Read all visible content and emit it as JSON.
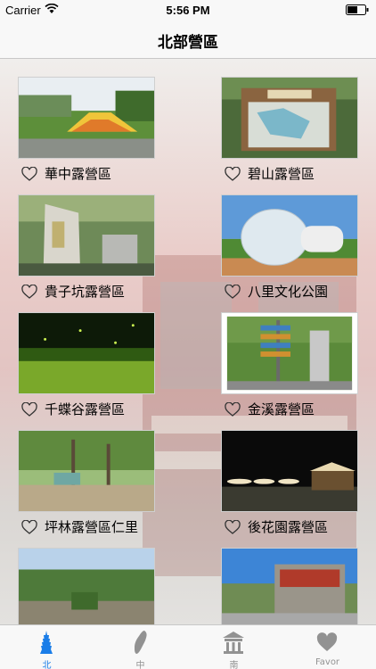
{
  "status_bar": {
    "carrier": "Carrier",
    "time": "5:56 PM"
  },
  "nav": {
    "title": "北部營區"
  },
  "campsites": [
    {
      "name": "華中露營區"
    },
    {
      "name": "碧山露營區"
    },
    {
      "name": "貴子坑露營區"
    },
    {
      "name": "八里文化公園"
    },
    {
      "name": "千蝶谷露營區"
    },
    {
      "name": "金溪露營區"
    },
    {
      "name": "坪林露營區仁里"
    },
    {
      "name": "後花園露營區"
    },
    {
      "name": ""
    },
    {
      "name": ""
    }
  ],
  "tabs": [
    {
      "label": "北",
      "icon": "taipei101-icon",
      "active": true
    },
    {
      "label": "中",
      "icon": "taiwan-map-icon",
      "active": false
    },
    {
      "label": "南",
      "icon": "temple-icon",
      "active": false
    },
    {
      "label": "Favor",
      "icon": "heart-icon",
      "active": false
    }
  ],
  "colors": {
    "accent": "#1a7de8",
    "tab_inactive": "#929292",
    "nav_bg": "#f8f8f8"
  }
}
